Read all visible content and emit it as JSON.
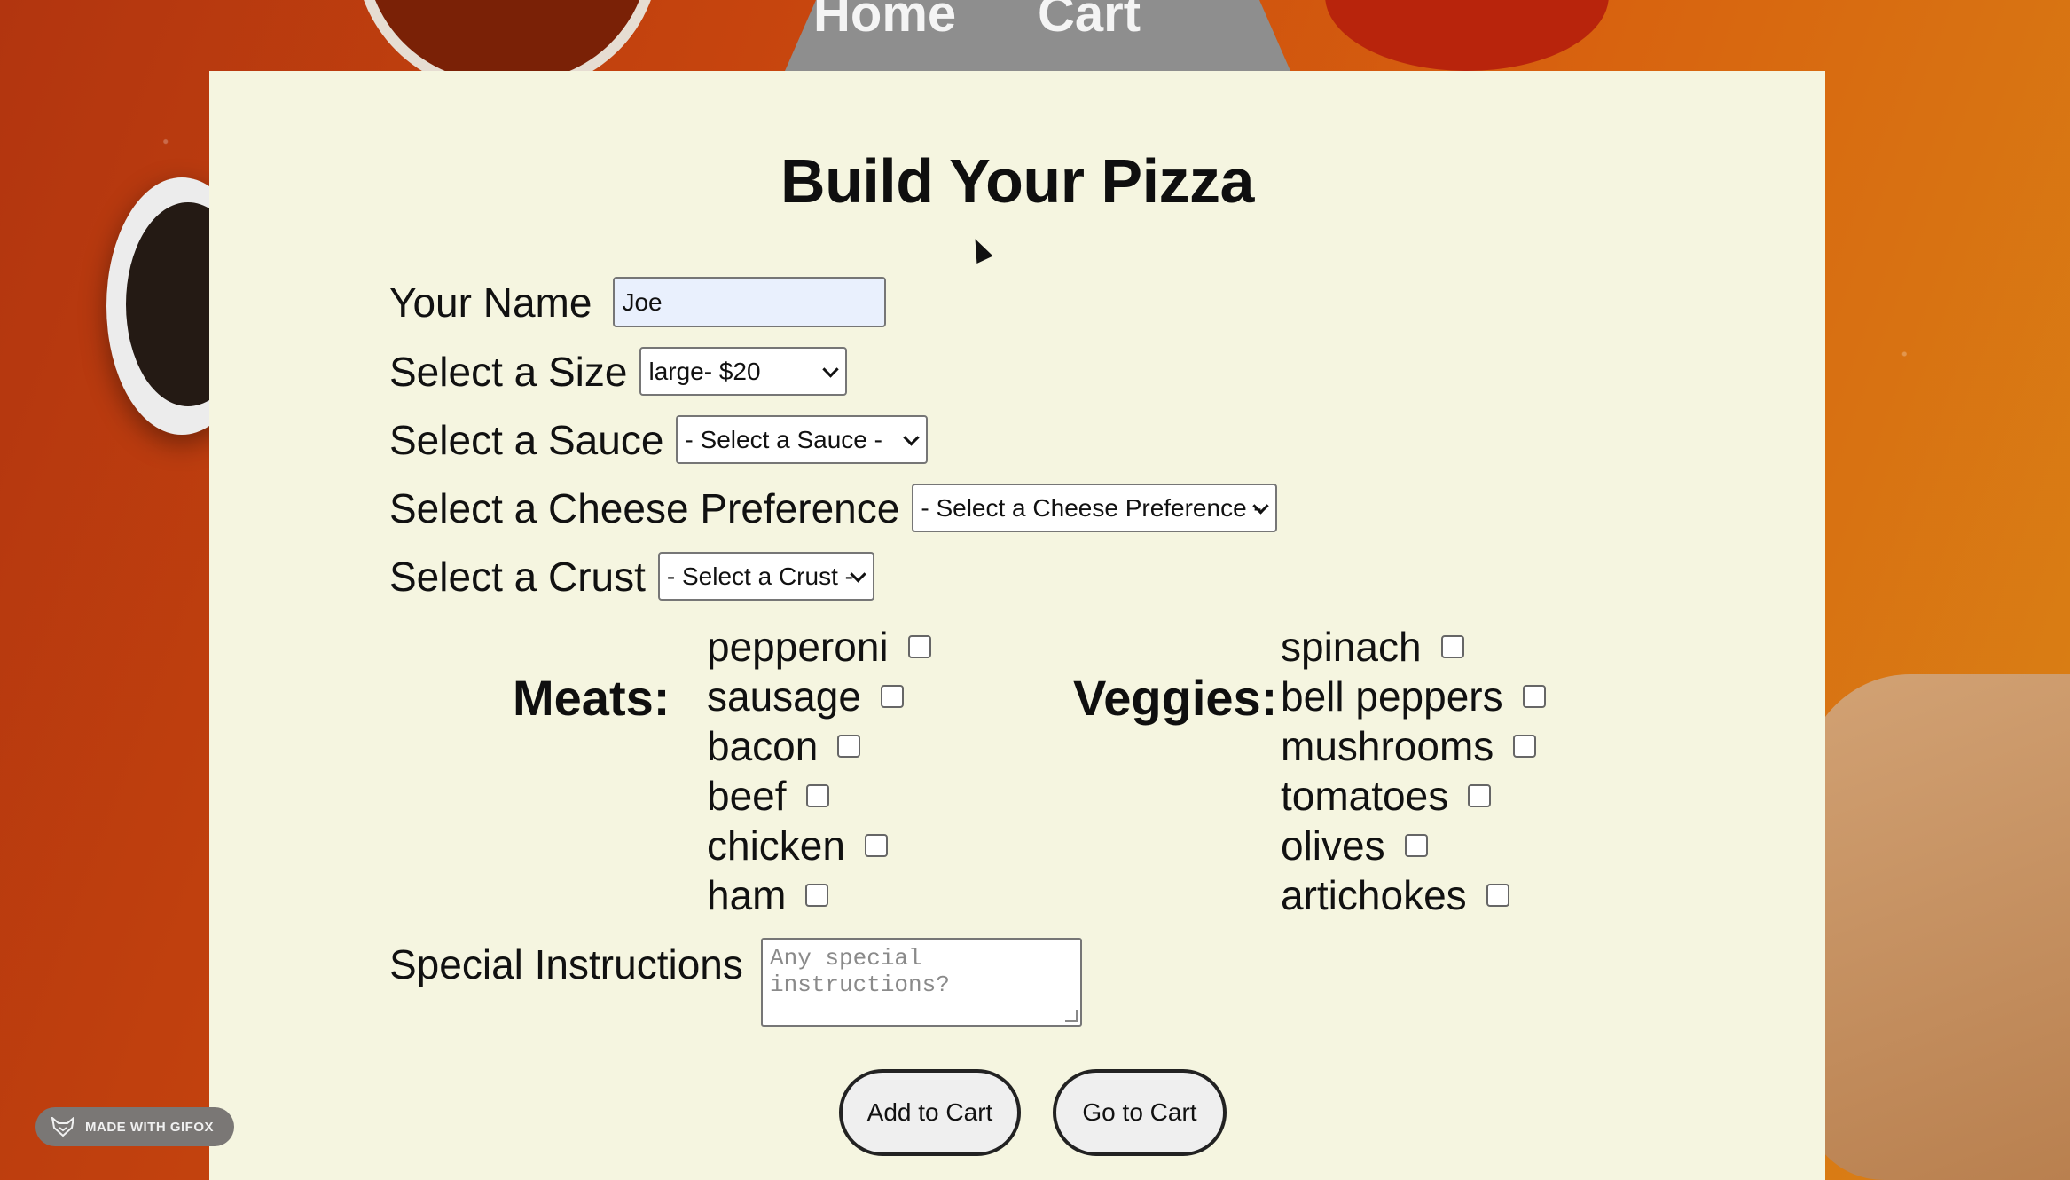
{
  "nav": {
    "home": "Home",
    "cart": "Cart"
  },
  "page": {
    "title": "Build Your Pizza"
  },
  "form": {
    "name_label": "Your Name",
    "name_value": "Joe",
    "size_label": "Select a Size",
    "size_value": "large- $20",
    "sauce_label": "Select a Sauce",
    "sauce_value": "- Select a Sauce -",
    "cheese_label": "Select a Cheese Preference",
    "cheese_value": "- Select a Cheese Preference -",
    "crust_label": "Select a Crust",
    "crust_value": "- Select a Crust -",
    "meats_label": "Meats:",
    "meats": [
      "pepperoni",
      "sausage",
      "bacon",
      "beef",
      "chicken",
      "ham"
    ],
    "veggies_label": "Veggies:",
    "veggies": [
      "spinach",
      "bell peppers",
      "mushrooms",
      "tomatoes",
      "olives",
      "artichokes"
    ],
    "instructions_label": "Special Instructions",
    "instructions_placeholder": "Any special instructions?"
  },
  "buttons": {
    "add_to_cart": "Add to Cart",
    "go_to_cart": "Go to Cart"
  },
  "badge": {
    "text": "MADE WITH GIFOX",
    "icon": "fox-icon"
  },
  "colors": {
    "panel": "#f5f5e0",
    "nav": "#8e8e8e",
    "name_input": "#e9f0fd"
  }
}
